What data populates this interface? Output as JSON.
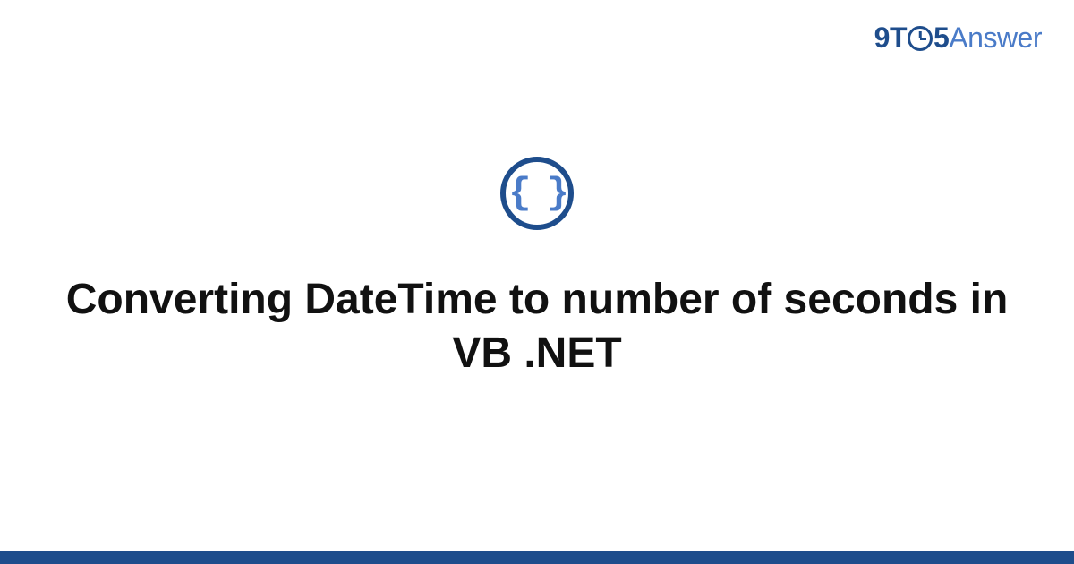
{
  "logo": {
    "part1": "9T",
    "part2": "5",
    "part3": "Answer"
  },
  "icon": {
    "type": "code-braces",
    "glyph": "{ }"
  },
  "title": "Converting DateTime to number of seconds in VB .NET",
  "colors": {
    "brand_dark": "#1e4d8c",
    "brand_light": "#4a7bc8"
  }
}
